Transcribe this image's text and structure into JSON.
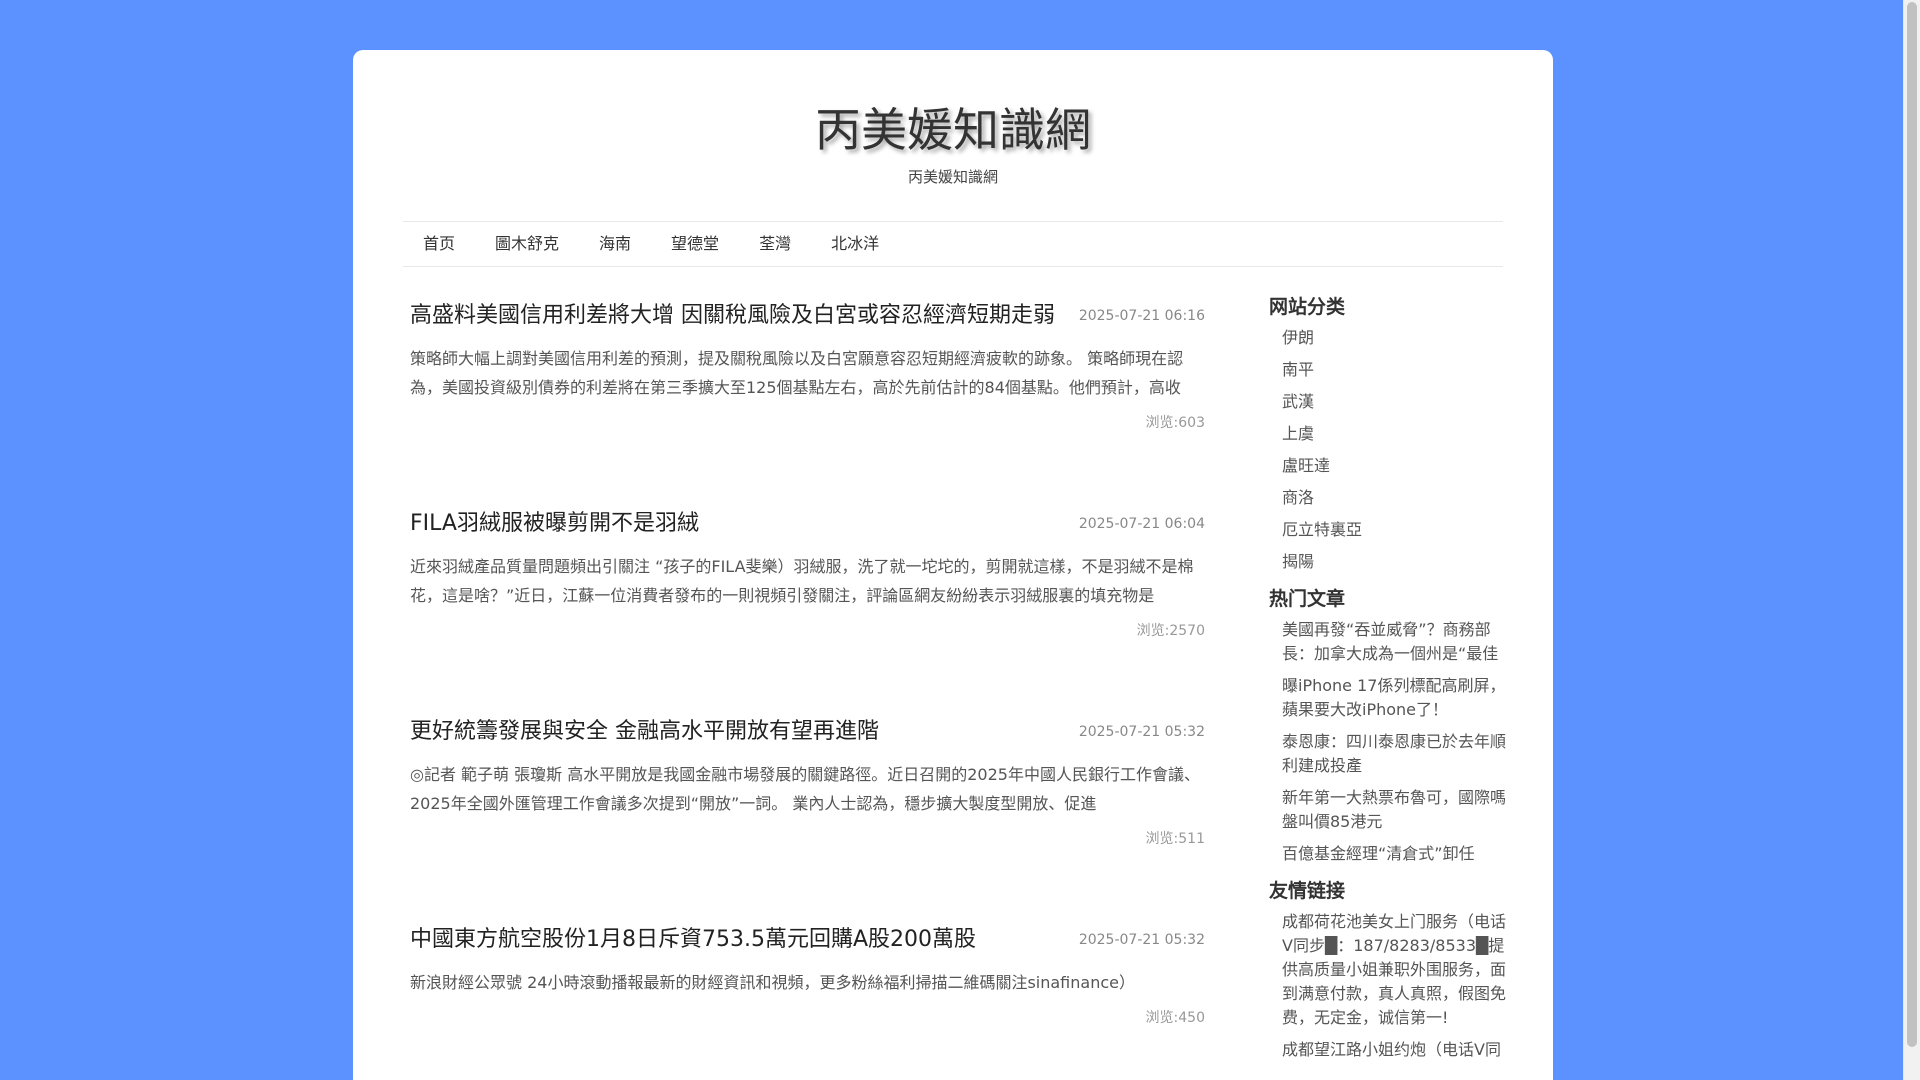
{
  "site": {
    "title": "丙美媛知識網",
    "description": "丙美媛知識網"
  },
  "nav": [
    "首页",
    "圖木舒克",
    "海南",
    "望德堂",
    "荃灣",
    "北冰洋"
  ],
  "articles": [
    {
      "title": "高盛料美國信用利差將大增 因關稅風險及白宮或容忍經濟短期走弱",
      "date": "2025-07-21 06:16",
      "summary": "策略師大幅上調對美國信用利差的預測，提及關稅風險以及白宮願意容忍短期經濟疲軟的跡象。 策略師現在認為，美國投資級別債券的利差將在第三季擴大至125個基點左右，高於先前估計的84個基點。他們預計，高收",
      "views": "浏览:603"
    },
    {
      "title": "FILA羽絨服被曝剪開不是羽絨",
      "date": "2025-07-21 06:04",
      "summary": "近來羽絨產品質量問題頻出引關注 “孩子的FILA斐樂）羽絨服，洗了就一坨坨的，剪開就這樣，不是羽絨不是棉花，這是啥？”近日，江蘇一位消費者發布的一則視頻引發關注，評論區網友紛紛表示羽絨服裏的填充物是",
      "views": "浏览:2570"
    },
    {
      "title": "更好統籌發展與安全 金融高水平開放有望再進階",
      "date": "2025-07-21 05:32",
      "summary": "◎記者 範子萌 張瓊斯 高水平開放是我國金融市場發展的關鍵路徑。近日召開的2025年中國人民銀行工作會議、2025年全國外匯管理工作會議多次提到“開放”一詞。 業內人士認為，穩步擴大製度型開放、促進",
      "views": "浏览:511"
    },
    {
      "title": "中國東方航空股份1月8日斥資753.5萬元回購A股200萬股",
      "date": "2025-07-21 05:32",
      "summary": "新浪財經公眾號 24小時滾動播報最新的財經資訊和視頻，更多粉絲福利掃描二維碼關注sinafinance）",
      "views": "浏览:450"
    }
  ],
  "sidebar": {
    "categories": {
      "title": "网站分类",
      "items": [
        "伊朗",
        "南平",
        "武漢",
        "上虞",
        "盧旺達",
        "商洛",
        "厄立特裏亞",
        "揭陽"
      ]
    },
    "hot": {
      "title": "热门文章",
      "items": [
        "美國再發“吞並威脅”？商務部長：加拿大成為一個州是“最佳",
        "曝iPhone 17係列標配高刷屏，蘋果要大改iPhone了！",
        "泰恩康：四川泰恩康已於去年順利建成投產",
        "新年第一大熱票布魯可，國際嗎盤叫價85港元",
        "百億基金經理“清倉式”卸任"
      ]
    },
    "links": {
      "title": "友情链接",
      "items": [
        "成都荷花池美女上门服务（电话V同步█：187/8283/8533█提供高质量小姐兼职外围服务，面到满意付款，真人真照，假图免费，无定金，诚信第一!",
        "成都望江路小姐约炮（电话V同"
      ]
    }
  }
}
